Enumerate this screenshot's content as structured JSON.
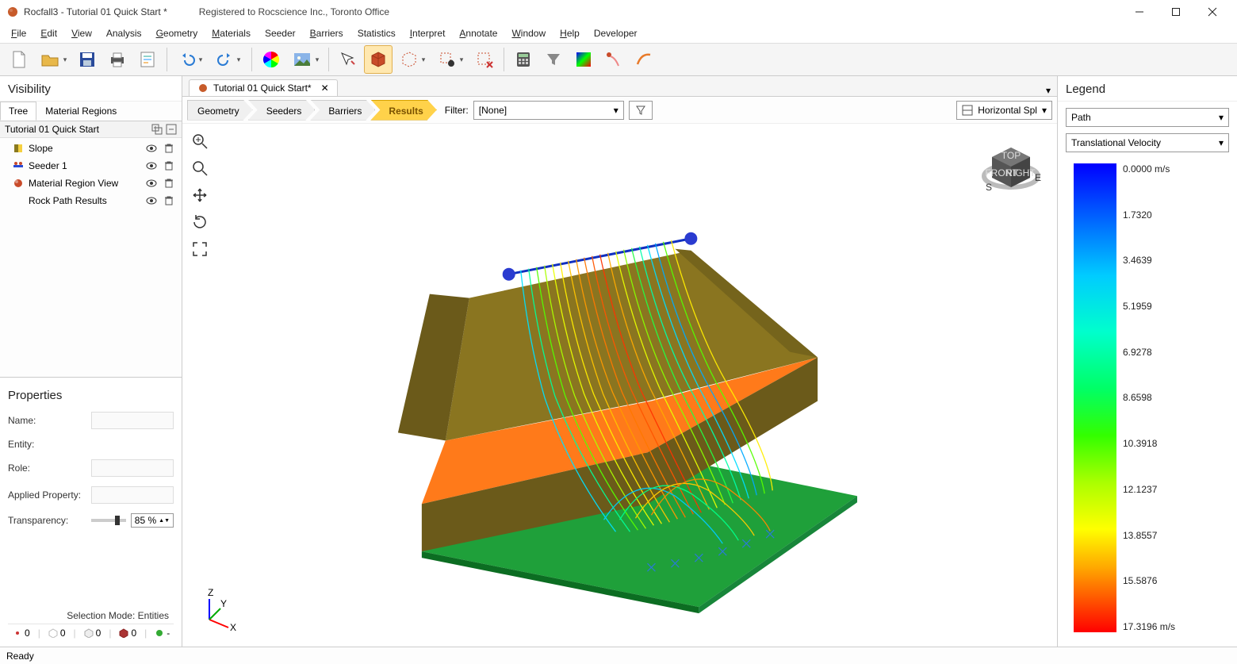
{
  "title": "Rocfall3 - Tutorial 01 Quick Start *",
  "registration": "Registered to Rocscience Inc., Toronto Office",
  "menu": [
    "File",
    "Edit",
    "View",
    "Analysis",
    "Geometry",
    "Materials",
    "Seeder",
    "Barriers",
    "Statistics",
    "Interpret",
    "Annotate",
    "Window",
    "Help",
    "Developer"
  ],
  "doc_tab": "Tutorial 01 Quick Start*",
  "breadcrumbs": [
    "Geometry",
    "Seeders",
    "Barriers",
    "Results"
  ],
  "filter": {
    "label": "Filter:",
    "value": "[None]"
  },
  "split_view": "Horizontal Spl",
  "visibility": {
    "title": "Visibility",
    "tabs": [
      "Tree",
      "Material Regions"
    ],
    "root": "Tutorial 01 Quick Start",
    "items": [
      "Slope",
      "Seeder 1",
      "Material Region View",
      "Rock Path Results"
    ]
  },
  "properties": {
    "title": "Properties",
    "labels": {
      "name": "Name:",
      "entity": "Entity:",
      "role": "Role:",
      "applied": "Applied Property:",
      "transparency": "Transparency:"
    },
    "transparency_value": "85 %",
    "selection_mode_label": "Selection Mode:",
    "selection_mode_value": "Entities",
    "bottom_counts": [
      "0",
      "0",
      "0",
      "0",
      "-"
    ]
  },
  "legend": {
    "title": "Legend",
    "sel1": "Path",
    "sel2": "Translational Velocity",
    "ticks": [
      "0.0000 m/s",
      "1.7320",
      "3.4639",
      "5.1959",
      "6.9278",
      "8.6598",
      "10.3918",
      "12.1237",
      "13.8557",
      "15.5876",
      "17.3196 m/s"
    ]
  },
  "status": "Ready",
  "chart_data": {
    "type": "scale",
    "label": "Translational Velocity (m/s)",
    "min": 0.0,
    "max": 17.3196,
    "ticks": [
      0.0,
      1.732,
      3.4639,
      5.1959,
      6.9278,
      8.6598,
      10.3918,
      12.1237,
      13.8557,
      15.5876,
      17.3196
    ]
  }
}
